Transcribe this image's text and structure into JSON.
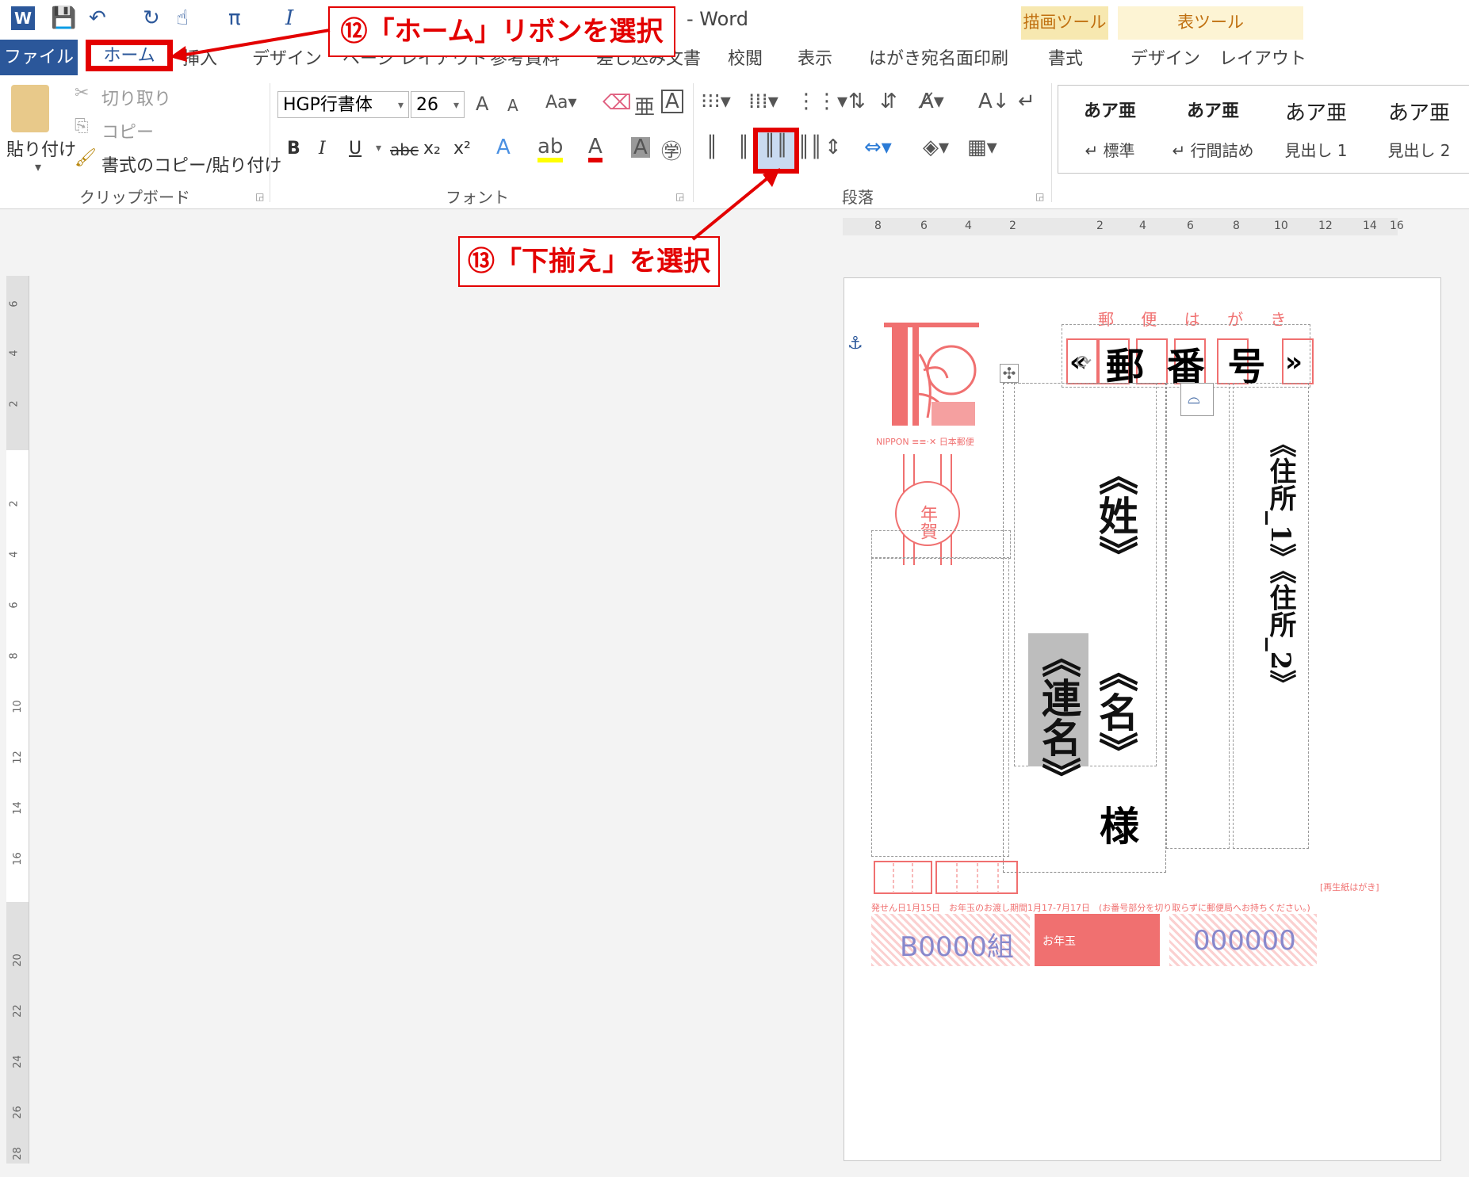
{
  "window": {
    "title": "- Word"
  },
  "quick_access": {
    "save": "💾",
    "undo": "↶",
    "redo": "↻",
    "touch": "☝",
    "equation": "π",
    "italic": "I"
  },
  "tabs": [
    {
      "label": "ファイル"
    },
    {
      "label": "ホーム"
    },
    {
      "label": "挿入"
    },
    {
      "label": "デザイン"
    },
    {
      "label": "ページ レイアウト"
    },
    {
      "label": "参考資料"
    },
    {
      "label": "差し込み文書"
    },
    {
      "label": "校閲"
    },
    {
      "label": "表示"
    },
    {
      "label": "はがき宛名面印刷"
    },
    {
      "label": "書式"
    },
    {
      "label": "デザイン"
    },
    {
      "label": "レイアウト"
    }
  ],
  "contextual": {
    "drawing_tools": "描画ツール",
    "table_tools": "表ツール",
    "drawing_color": "#f7e8b0",
    "table_color": "#fdf4d4"
  },
  "clipboard": {
    "paste": "貼り付け",
    "cut": "切り取り",
    "copy": "コピー",
    "format_painter": "書式のコピー/貼り付け",
    "group": "クリップボード"
  },
  "font": {
    "name": "HGP行書体",
    "size": "26",
    "bold": "B",
    "italic": "I",
    "underline": "U",
    "strike": "abc",
    "sub": "x₂",
    "sup": "x²",
    "group": "フォント"
  },
  "paragraph": {
    "group": "段落"
  },
  "styles": [
    {
      "sample": "あア亜",
      "name": "↵ 標準"
    },
    {
      "sample": "あア亜",
      "name": "↵ 行間詰め"
    },
    {
      "sample": "あア亜",
      "name": "見出し 1"
    },
    {
      "sample": "あア亜",
      "name": "見出し 2"
    }
  ],
  "ruler": {
    "h": [
      "8",
      "6",
      "4",
      "2",
      "2",
      "4",
      "6",
      "8",
      "10",
      "12",
      "14",
      "16"
    ],
    "v": [
      "6",
      "4",
      "2",
      "2",
      "4",
      "6",
      "8",
      "10",
      "12",
      "14",
      "16",
      "20",
      "22",
      "24",
      "26",
      "28"
    ]
  },
  "callouts": {
    "c12": "⑫「ホーム」リボンを選択",
    "c13": "⑬「下揃え」を選択",
    "color": "#e30000"
  },
  "postcard": {
    "header": "郵 便 は が き",
    "postal_open": "«",
    "postal_text": "郵 番 号",
    "postal_close": "»",
    "nippon": "NIPPON ≡≡·✕ 日本郵便",
    "nenga": "年賀",
    "address": "《住所_1》《住所_2》",
    "surname": "《姓》",
    "given": "《名》",
    "sama": "様",
    "renmei": "《連名》",
    "recycled": "[再生紙はがき]",
    "notice": "発せん日1月15日　お年玉のお渡し期間1月17-7月17日　(お番号部分を切り取らずに郵便局へお持ちください。)",
    "group": "B0000組",
    "lottery": "お年玉",
    "number": "000000"
  }
}
